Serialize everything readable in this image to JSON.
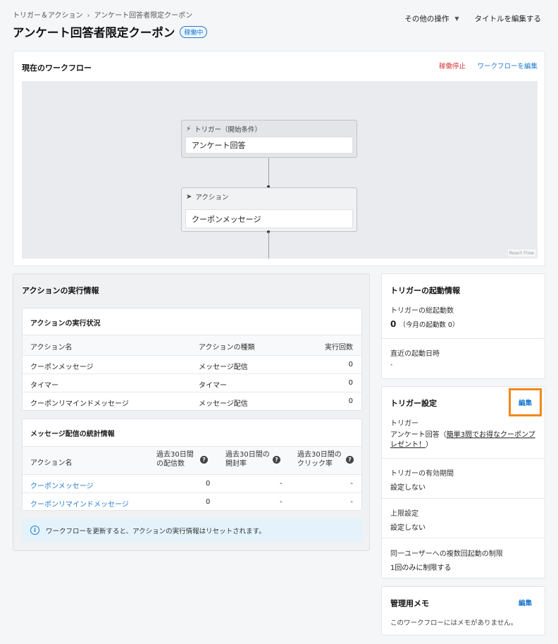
{
  "breadcrumb": {
    "parent": "トリガー＆アクション",
    "current": "アンケート回答者限定クーポン"
  },
  "page": {
    "title": "アンケート回答者限定クーポン",
    "status_badge": "稼働中"
  },
  "top_actions": {
    "other_ops": "その他の操作",
    "edit_title": "タイトルを編集する"
  },
  "workflow": {
    "title": "現在のワークフロー",
    "stop_label": "稼働停止",
    "edit_label": "ワークフローを編集",
    "trigger_node": {
      "header": "トリガー（開始条件）",
      "value": "アンケート回答"
    },
    "action_node": {
      "header": "アクション",
      "value": "クーポンメッセージ"
    },
    "attribution": "React Flow"
  },
  "exec_info": {
    "title": "アクションの実行情報",
    "status": {
      "title": "アクションの実行状況",
      "headers": [
        "アクション名",
        "アクションの種類",
        "実行回数"
      ],
      "rows": [
        [
          "クーポンメッセージ",
          "メッセージ配信",
          "0"
        ],
        [
          "タイマー",
          "タイマー",
          "0"
        ],
        [
          "クーポンリマインドメッセージ",
          "メッセージ配信",
          "0"
        ]
      ]
    },
    "stats": {
      "title": "メッセージ配信の統計情報",
      "headers": [
        "アクション名",
        "過去30日間の配信数",
        "過去30日間の開封率",
        "過去30日間のクリック率"
      ],
      "header_lines": [
        [
          "過去30日間",
          "の配信数"
        ],
        [
          "過去30日間の",
          "開封率"
        ],
        [
          "過去30日間の",
          "クリック率"
        ]
      ],
      "rows": [
        [
          "クーポンメッセージ",
          "0",
          "-",
          "-"
        ],
        [
          "クーポンリマインドメッセージ",
          "0",
          "-",
          "-"
        ]
      ]
    },
    "notice": "ワークフローを更新すると、アクションの実行情報はリセットされます。"
  },
  "trigger_stats": {
    "title": "トリガーの起動情報",
    "total_label": "トリガーの総起動数",
    "total_value": "0",
    "month_value": "（今月の起動数 0）",
    "recent_label": "直近の起動日時",
    "recent_value": "-"
  },
  "trigger_settings": {
    "title": "トリガー設定",
    "edit_label": "編集",
    "trigger_label": "トリガー",
    "trigger_value_prefix": "アンケート回答（",
    "trigger_value_link_1": "簡単3問でお得なクーポンプ",
    "trigger_value_link_2": "レゼント！",
    "trigger_value_suffix": "）",
    "validity_label": "トリガーの有効期間",
    "validity_value": "設定しない",
    "limit_label": "上限設定",
    "limit_value": "設定しない",
    "multi_label": "同一ユーザーへの複数回起動の制限",
    "multi_value": "1回のみに制限する"
  },
  "memo": {
    "title": "管理用メモ",
    "edit_label": "編集",
    "empty_text": "このワークフローにはメモがありません。"
  }
}
